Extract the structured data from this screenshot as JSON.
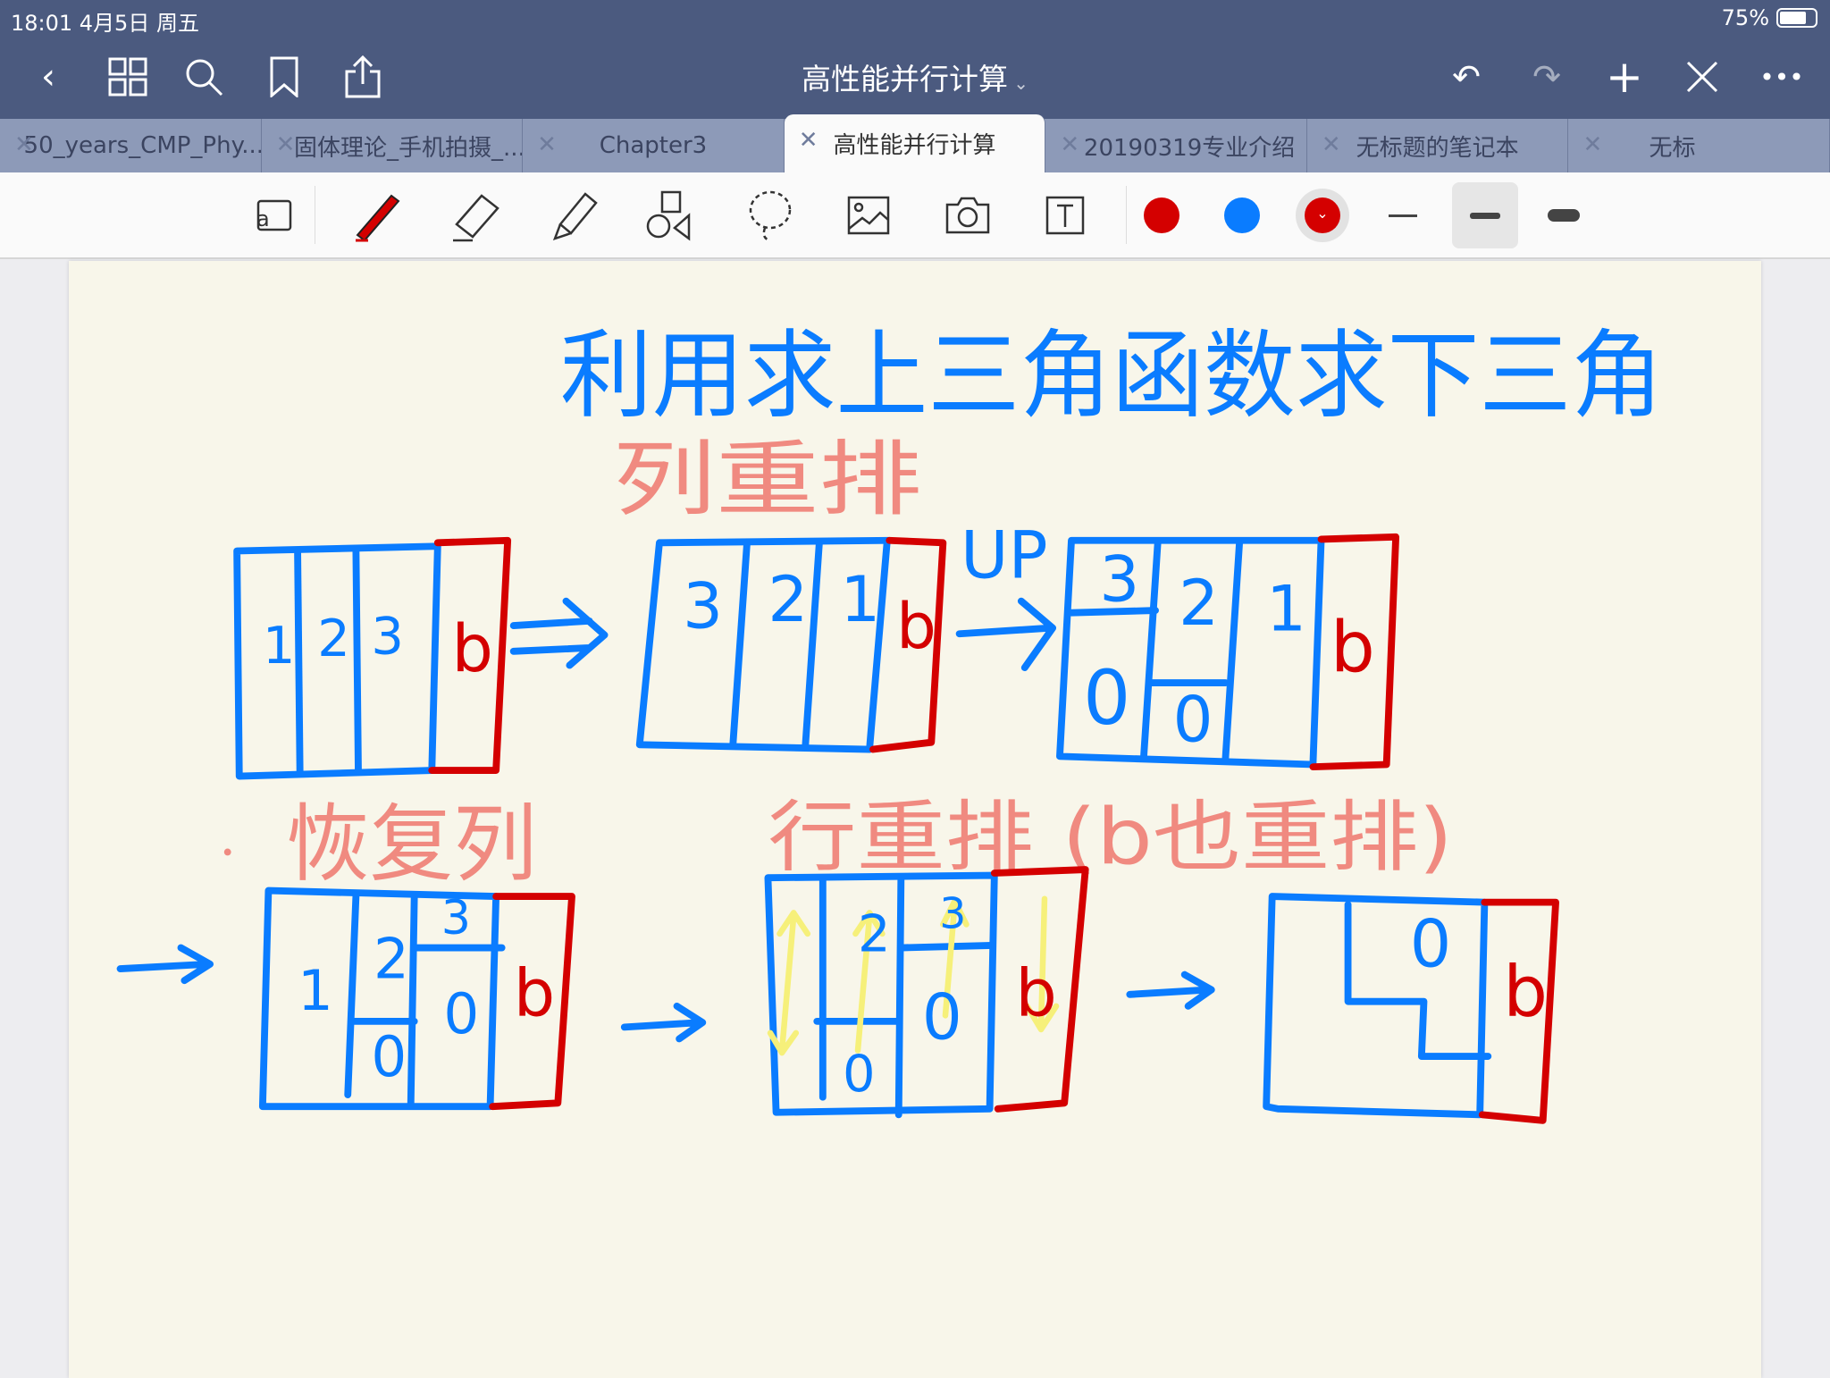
{
  "status": {
    "time": "18:01  4月5日 周五",
    "battery": "75%",
    "battery_level": 0.75
  },
  "nav": {
    "title": "高性能并行计算",
    "icons": [
      "back-icon",
      "grid-icon",
      "search-icon",
      "bookmark-icon",
      "share-icon",
      "undo-icon",
      "redo-icon",
      "add-icon",
      "close-pen-icon",
      "more-icon"
    ]
  },
  "tabs": [
    {
      "label": "50_years_CMP_Phy..."
    },
    {
      "label": "固体理论_手机拍摄_..."
    },
    {
      "label": "Chapter3"
    },
    {
      "label": "高性能并行计算",
      "active": true
    },
    {
      "label": "20190319专业介绍"
    },
    {
      "label": "无标题的笔记本"
    },
    {
      "label": "无标"
    }
  ],
  "toolbar": {
    "tools": [
      "read-mode",
      "pen",
      "eraser",
      "highlighter",
      "shapes",
      "lasso",
      "image",
      "camera",
      "text"
    ],
    "colors": [
      "#d40000",
      "#0a7cff",
      "#d40000"
    ],
    "selected_color": "#d40000",
    "stroke_widths": [
      "thin",
      "medium",
      "thick"
    ],
    "selected_width": "medium"
  },
  "note": {
    "title": "利用求上三角函数求下三角",
    "col_reorder": "列重排",
    "up": "UP",
    "restore_col": "恢复列",
    "row_reorder": "行重排 (b也重排)",
    "cells": {
      "one": "1",
      "two": "2",
      "three": "3",
      "zero": "0",
      "b": "b"
    },
    "colors": {
      "blue": "#0a7cff",
      "red": "#d40000",
      "pink": "#f08a80",
      "yellow": "#f6f07a"
    }
  }
}
